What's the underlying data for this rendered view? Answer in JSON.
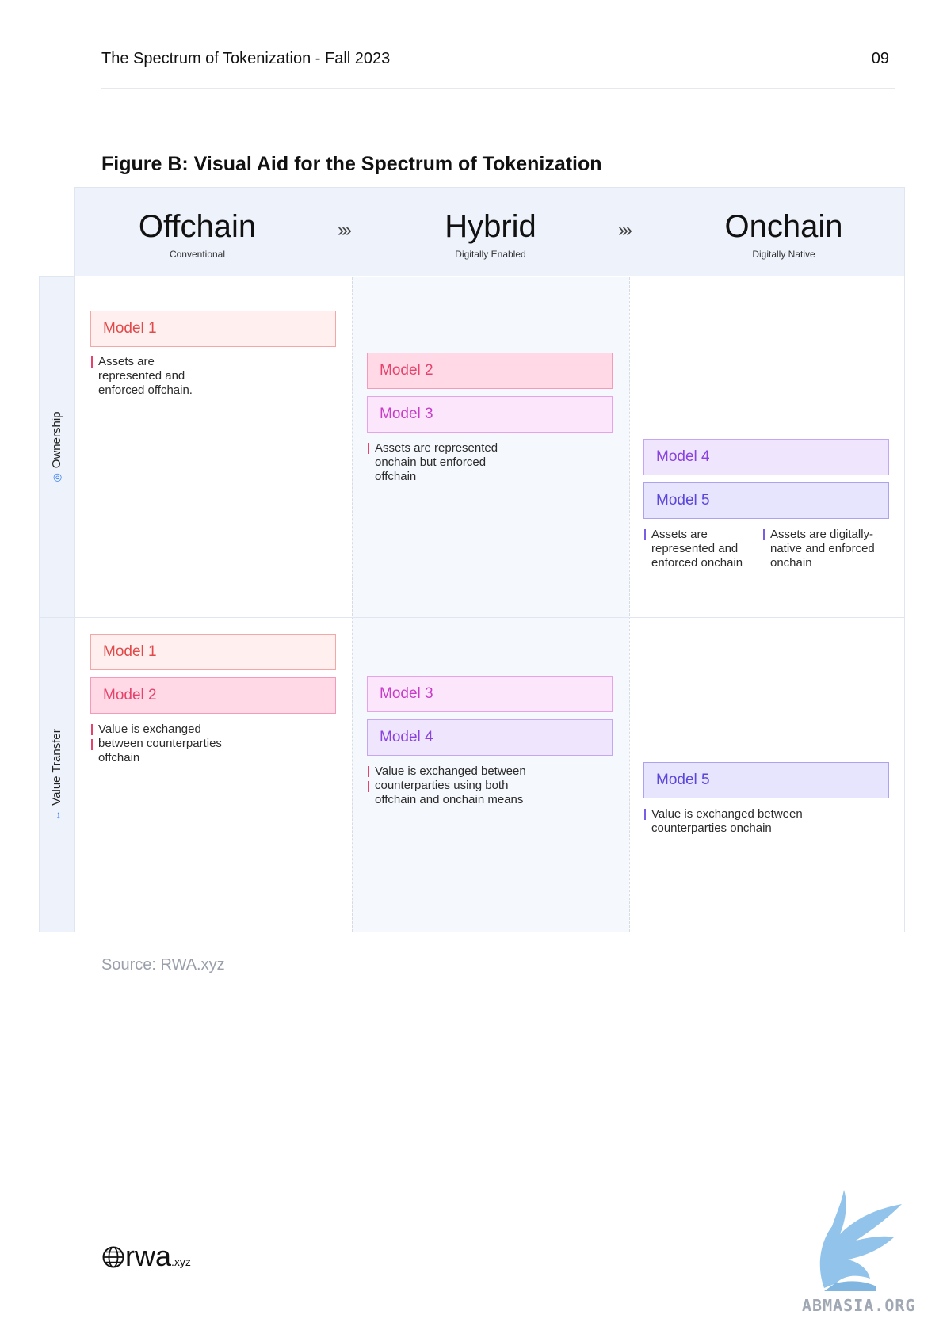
{
  "header": {
    "doc_title": "The Spectrum of Tokenization - Fall 2023",
    "page_number": "09"
  },
  "figure": {
    "title": "Figure B: Visual Aid for the Spectrum of Tokenization",
    "columns": [
      {
        "name": "Offchain",
        "subtitle": "Conventional"
      },
      {
        "name": "Hybrid",
        "subtitle": "Digitally Enabled"
      },
      {
        "name": "Onchain",
        "subtitle": "Digitally Native"
      }
    ],
    "arrow_glyph": "›››",
    "rows": [
      {
        "label": "Ownership",
        "icon": "ownership-icon",
        "icon_glyph": "◎"
      },
      {
        "label": "Value Transfer",
        "icon": "arrows-icon",
        "icon_glyph": "↔"
      }
    ],
    "ownership": {
      "offchain": {
        "models": [
          "Model 1"
        ],
        "desc": [
          "Assets are",
          "represented and",
          "enforced offchain."
        ]
      },
      "hybrid": {
        "models": [
          "Model 2",
          "Model 3"
        ],
        "desc": [
          "Assets are represented",
          "onchain but enforced",
          "offchain"
        ]
      },
      "onchain": {
        "models": [
          "Model 4",
          "Model 5"
        ],
        "desc_left": [
          "Assets are",
          "represented and",
          "enforced onchain"
        ],
        "desc_right": [
          "Assets are digitally-",
          "native and enforced",
          "onchain"
        ]
      }
    },
    "value_transfer": {
      "offchain": {
        "models": [
          "Model 1",
          "Model 2"
        ],
        "desc": [
          "Value is exchanged",
          "between counterparties",
          "offchain"
        ]
      },
      "hybrid": {
        "models": [
          "Model 3",
          "Model 4"
        ],
        "desc": [
          "Value is exchanged between",
          "counterparties using both",
          "offchain and onchain means"
        ]
      },
      "onchain": {
        "models": [
          "Model 5"
        ],
        "desc": [
          "Value is exchanged between",
          "counterparties onchain"
        ]
      }
    },
    "source": "Source: RWA.xyz"
  },
  "footer": {
    "logo_text": "rwa",
    "logo_tld": ".xyz",
    "watermark": "ABMASIA.ORG"
  },
  "colors": {
    "model_1": "#e04a4a",
    "model_2": "#e5436c",
    "model_3": "#c83cc8",
    "model_4": "#8a43df",
    "model_5": "#5a45dd",
    "band": "#eef2fb"
  }
}
